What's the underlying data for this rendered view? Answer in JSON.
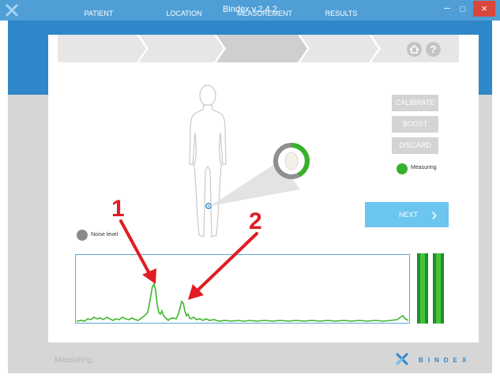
{
  "window": {
    "title": "Bindex v.2.4.2",
    "minimize_glyph": "–",
    "maximize_glyph": "□",
    "close_glyph": "×"
  },
  "steps": [
    {
      "label": "PATIENT",
      "active": false
    },
    {
      "label": "LOCATION",
      "active": false
    },
    {
      "label": "MEASUREMENT",
      "active": true
    },
    {
      "label": "RESULTS",
      "active": false
    }
  ],
  "help_glyph": "?",
  "buttons": {
    "calibrate": "CALIBRATE",
    "boost": "BOOST",
    "discard": "DISCARD",
    "next": "NEXT",
    "next_chevron": "›"
  },
  "indicators": {
    "measuring": "Measuring",
    "noise_level": "Noise level"
  },
  "annotations": {
    "peak_1": "1",
    "peak_2": "2"
  },
  "status": "Measuring...",
  "brand": "BINDEX",
  "colors": {
    "title_bar": "#4f9fd6",
    "header_band": "#2f86c8",
    "step_inactive": "#e6e6e6",
    "step_active": "#cfcfcf",
    "accent_green": "#37b12b",
    "next_button": "#6cc5ee",
    "annotation_red": "#e21c24"
  }
}
